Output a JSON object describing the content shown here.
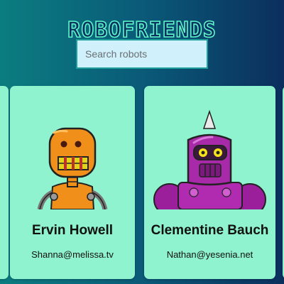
{
  "header": {
    "title": "ROBOFRIENDS"
  },
  "search": {
    "placeholder": "Search robots",
    "value": ""
  },
  "robots": [
    {
      "name": "Ervin Howell",
      "email": "Shanna@melissa.tv",
      "icon": "orange-robot-avatar"
    },
    {
      "name": "Clementine Bauch",
      "email": "Nathan@yesenia.net",
      "icon": "purple-robot-avatar"
    }
  ],
  "colors": {
    "background_left": "#0b7d80",
    "background_right": "#0b2f5e",
    "card": "#8ff3cf",
    "title_outline": "#5ef5c9",
    "search_bg": "#d0f0fb"
  }
}
